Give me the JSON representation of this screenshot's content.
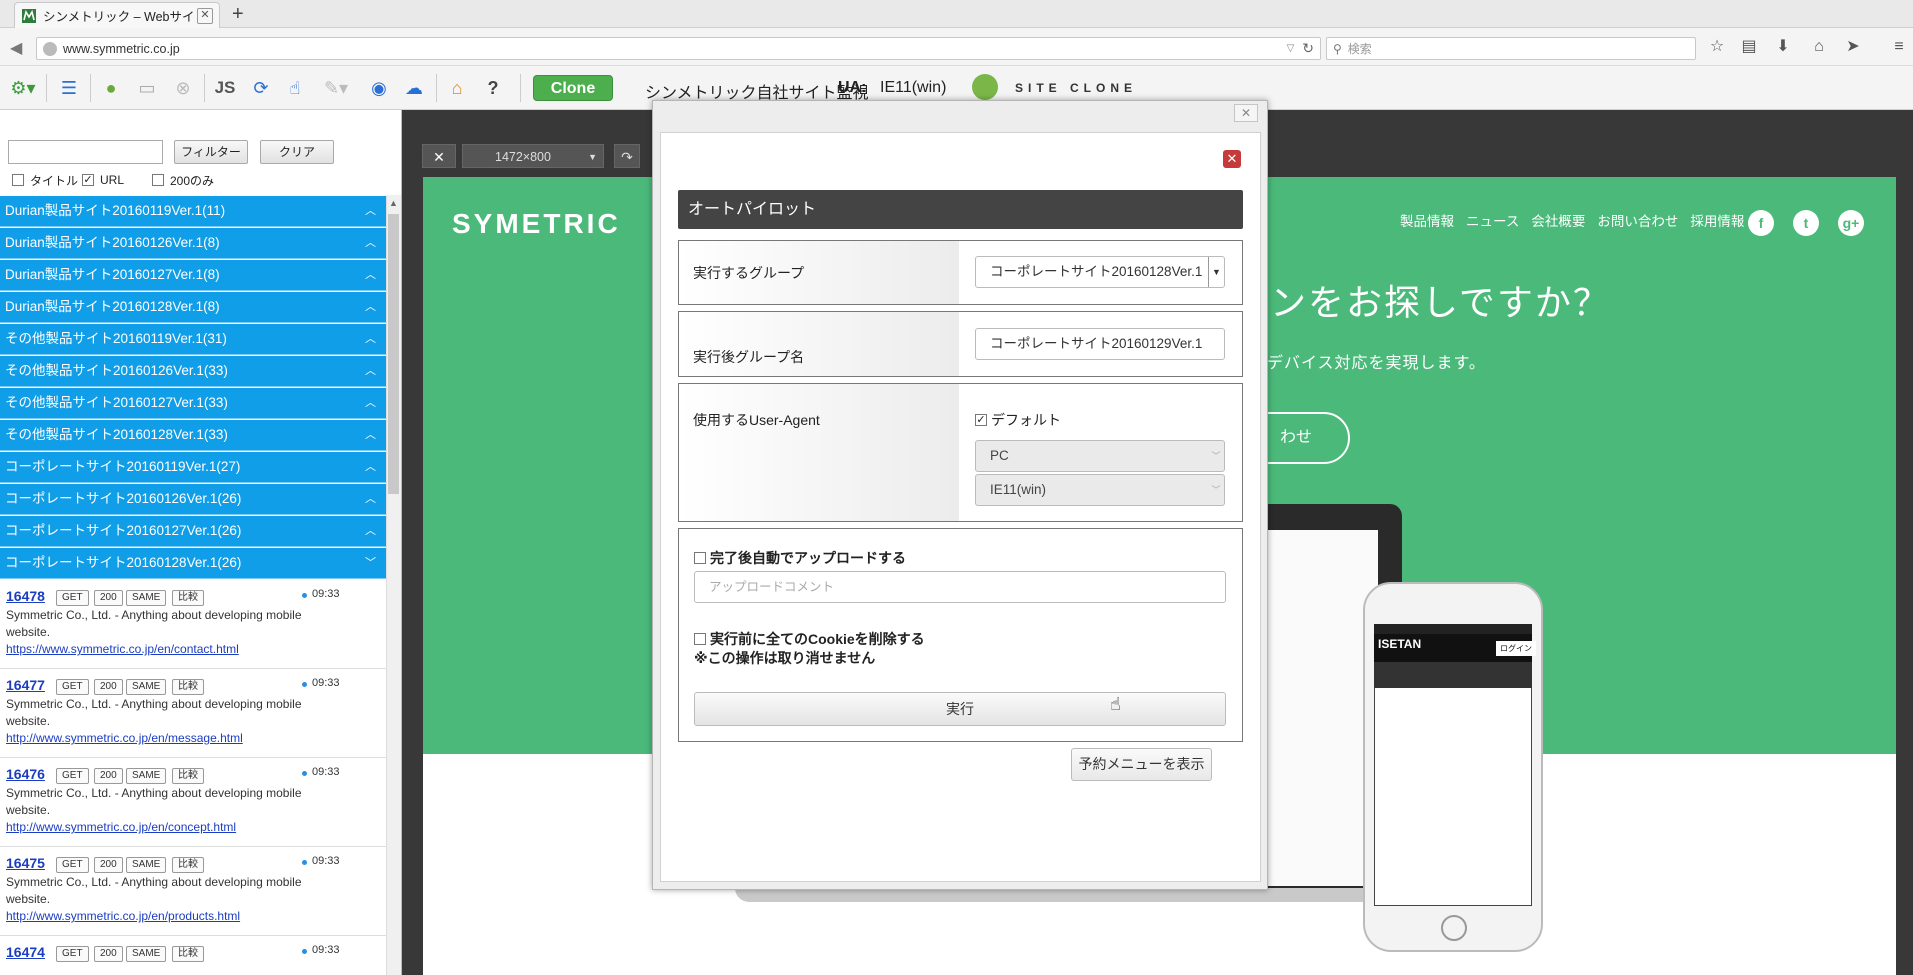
{
  "browser": {
    "tab_title": "シンメトリック – Webサイト...",
    "tab_close": "✕",
    "new_tab": "+",
    "url": "www.symmetric.co.jp",
    "search_placeholder": "検索"
  },
  "toolbar": {
    "js_label": "JS",
    "help_label": "?",
    "clone_label": "Clone",
    "monitor_label": "シンメトリック自社サイト監視",
    "ua_label": "UA:",
    "ua_value": "IE11(win)",
    "siteclone_text": "SITE CLONE"
  },
  "sidebar": {
    "filter_button": "フィルター",
    "clear_button": "クリア",
    "checkboxes": [
      {
        "label": "タイトル",
        "checked": false
      },
      {
        "label": "URL",
        "checked": true
      },
      {
        "label": "200のみ",
        "checked": false
      }
    ],
    "groups": [
      "Durian製品サイト20160119Ver.1(11)",
      "Durian製品サイト20160126Ver.1(8)",
      "Durian製品サイト20160127Ver.1(8)",
      "Durian製品サイト20160128Ver.1(8)",
      "その他製品サイト20160119Ver.1(31)",
      "その他製品サイト20160126Ver.1(33)",
      "その他製品サイト20160127Ver.1(33)",
      "その他製品サイト20160128Ver.1(33)",
      "コーポレートサイト20160119Ver.1(27)",
      "コーポレートサイト20160126Ver.1(26)",
      "コーポレートサイト20160127Ver.1(26)",
      "コーポレートサイト20160128Ver.1(26)"
    ],
    "tags": [
      "GET",
      "200",
      "SAME",
      "比較"
    ],
    "items": [
      {
        "id": "16478",
        "time": "09:33",
        "desc": "Symmetric Co., Ltd. - Anything about developing mobile website.",
        "url": "https://www.symmetric.co.jp/en/contact.html"
      },
      {
        "id": "16477",
        "time": "09:33",
        "desc": "Symmetric Co., Ltd. - Anything about developing mobile website.",
        "url": "http://www.symmetric.co.jp/en/message.html"
      },
      {
        "id": "16476",
        "time": "09:33",
        "desc": "Symmetric Co., Ltd. - Anything about developing mobile website.",
        "url": "http://www.symmetric.co.jp/en/concept.html"
      },
      {
        "id": "16475",
        "time": "09:33",
        "desc": "Symmetric Co., Ltd. - Anything about developing mobile website.",
        "url": "http://www.symmetric.co.jp/en/products.html"
      },
      {
        "id": "16474",
        "time": "09:33",
        "desc": "",
        "url": ""
      }
    ]
  },
  "preview": {
    "close": "✕",
    "size": "1472×800",
    "site_logo": "SYMETRIC",
    "nav": [
      "製品情報",
      "ニュース",
      "会社概要",
      "お問い合わせ",
      "採用情報"
    ],
    "social": [
      "f",
      "t",
      "g+"
    ],
    "hero_title": "ンをお探しですか？",
    "hero_sub": "デバイス対応を実現します。",
    "hero_btn": "わせ",
    "phone_logo": "ISETAN",
    "phone_login": "ログイン"
  },
  "dialog": {
    "title": "オートパイロット",
    "group_label": "実行するグループ",
    "group_value": "コーポレートサイト20160128Ver.1",
    "after_label": "実行後グループ名",
    "after_value": "コーポレートサイト20160129Ver.1",
    "ua_label": "使用するUser-Agent",
    "default_label": "デフォルト",
    "default_checked": true,
    "device_value": "PC",
    "browser_value": "IE11(win)",
    "upload_label": "完了後自動でアップロードする",
    "upload_placeholder": "アップロードコメント",
    "cookie_label": "実行前に全てのCookieを削除する",
    "cookie_warning": "※この操作は取り消せません",
    "execute_button": "実行",
    "reserve_button": "予約メニューを表示"
  }
}
